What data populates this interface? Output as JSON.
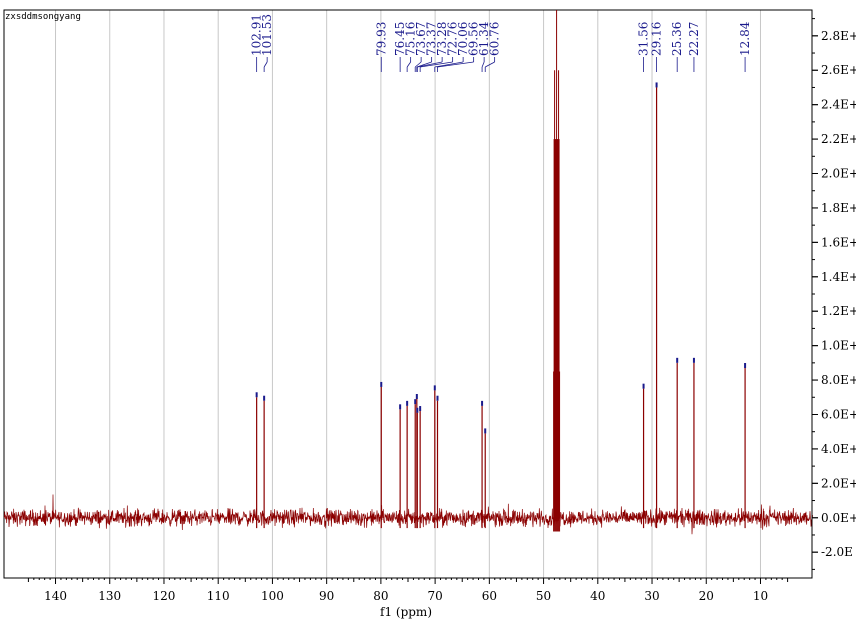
{
  "sample_label": "zxsddmsongyang",
  "colors": {
    "trace": "#8b0000",
    "peak_text": "#1a1a8c",
    "grid": "#c8c8c8",
    "axis": "#000000"
  },
  "chart_data": {
    "type": "line",
    "title": "",
    "xlabel": "f1 (ppm)",
    "ylabel": "",
    "x_reversed": true,
    "xlim": [
      149.5,
      0.5
    ],
    "ylim": [
      -35000000.0,
      295000000.0
    ],
    "x_ticks": [
      140,
      130,
      120,
      110,
      100,
      90,
      80,
      70,
      60,
      50,
      40,
      30,
      20,
      10
    ],
    "y_ticks": [
      {
        "value": -20000000.0,
        "label": "-2.0E"
      },
      {
        "value": 0,
        "label": "0.0E+"
      },
      {
        "value": 20000000.0,
        "label": "2.0E+"
      },
      {
        "value": 40000000.0,
        "label": "4.0E+"
      },
      {
        "value": 60000000.0,
        "label": "6.0E+"
      },
      {
        "value": 80000000.0,
        "label": "8.0E+"
      },
      {
        "value": 100000000.0,
        "label": "1.0E+"
      },
      {
        "value": 120000000.0,
        "label": "1.2E+"
      },
      {
        "value": 140000000.0,
        "label": "1.4E+"
      },
      {
        "value": 160000000.0,
        "label": "1.6E+"
      },
      {
        "value": 180000000.0,
        "label": "1.8E+"
      },
      {
        "value": 200000000.0,
        "label": "2.0E+"
      },
      {
        "value": 220000000.0,
        "label": "2.2E+"
      },
      {
        "value": 240000000.0,
        "label": "2.4E+"
      },
      {
        "value": 260000000.0,
        "label": "2.6E+"
      },
      {
        "value": 280000000.0,
        "label": "2.8E+"
      }
    ],
    "grid": true,
    "noise_amplitude": 7000000.0,
    "solvent": {
      "center": 47.6,
      "width": 1.1,
      "height": 295000000.0
    },
    "peaks": [
      {
        "ppm": 102.91,
        "label": "102.91",
        "height": 70000000.0
      },
      {
        "ppm": 101.53,
        "label": "101.53",
        "height": 68000000.0
      },
      {
        "ppm": 79.93,
        "label": "79.93",
        "height": 76000000.0
      },
      {
        "ppm": 76.45,
        "label": "76.45",
        "height": 63000000.0
      },
      {
        "ppm": 75.16,
        "label": "75.16",
        "height": 65000000.0
      },
      {
        "ppm": 73.67,
        "label": "73.67",
        "height": 66000000.0
      },
      {
        "ppm": 73.37,
        "label": "73.37",
        "height": 69000000.0
      },
      {
        "ppm": 73.28,
        "label": "73.28",
        "height": 61000000.0
      },
      {
        "ppm": 72.76,
        "label": "72.76",
        "height": 62000000.0
      },
      {
        "ppm": 70.06,
        "label": "70.06",
        "height": 74000000.0
      },
      {
        "ppm": 69.56,
        "label": "69.56",
        "height": 68000000.0
      },
      {
        "ppm": 61.34,
        "label": "61.34",
        "height": 65000000.0
      },
      {
        "ppm": 60.76,
        "label": "60.76",
        "height": 49000000.0
      },
      {
        "ppm": 31.56,
        "label": "31.56",
        "height": 75000000.0
      },
      {
        "ppm": 29.16,
        "label": "29.16",
        "height": 250000000.0
      },
      {
        "ppm": 25.36,
        "label": "25.36",
        "height": 90000000.0
      },
      {
        "ppm": 22.27,
        "label": "22.27",
        "height": 90000000.0
      },
      {
        "ppm": 12.84,
        "label": "12.84",
        "height": 87000000.0
      }
    ]
  }
}
